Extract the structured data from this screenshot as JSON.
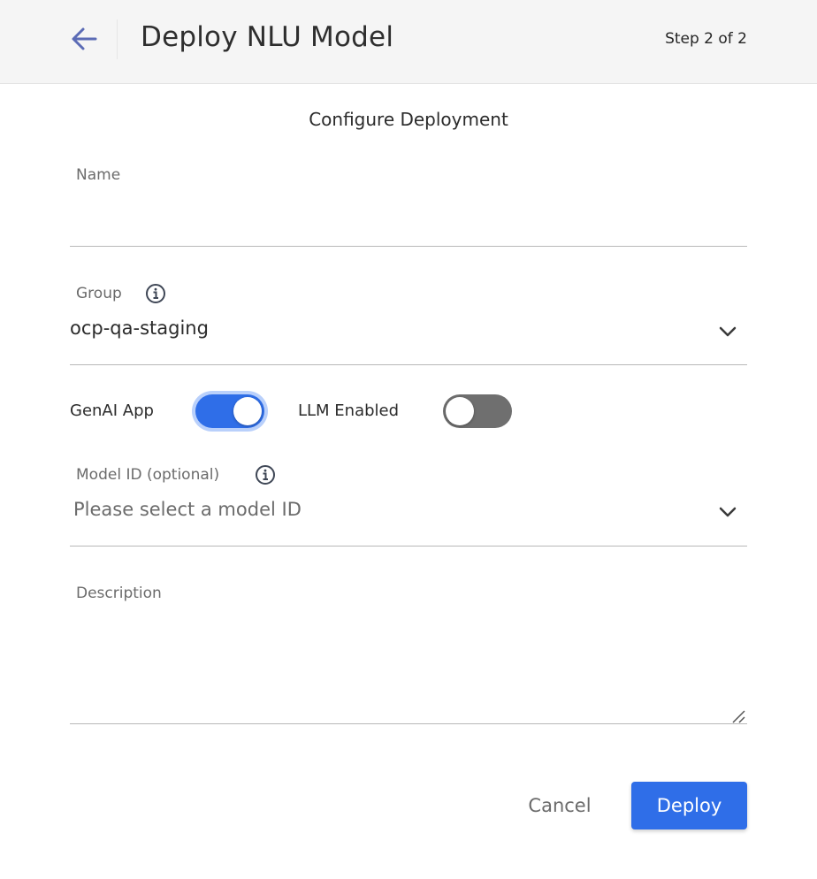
{
  "header": {
    "title": "Deploy NLU Model",
    "step": "Step 2 of 2"
  },
  "form": {
    "section_title": "Configure Deployment",
    "name": {
      "label": "Name",
      "value": ""
    },
    "group": {
      "label": "Group",
      "value": "ocp-qa-staging"
    },
    "genai_app": {
      "label": "GenAI App",
      "enabled": true
    },
    "llm_enabled": {
      "label": "LLM Enabled",
      "enabled": false
    },
    "model_id": {
      "label": "Model ID (optional)",
      "placeholder": "Please select a model ID"
    },
    "description": {
      "label": "Description",
      "value": ""
    }
  },
  "actions": {
    "cancel_label": "Cancel",
    "deploy_label": "Deploy"
  },
  "colors": {
    "primary": "#2f6ee8",
    "back_arrow": "#5b6bb5",
    "toggle_off": "#6f6f6f"
  },
  "icons": {
    "back": "arrow-left-icon",
    "info": "info-icon",
    "dropdown": "chevron-down-icon",
    "resize": "resize-grip-icon"
  }
}
